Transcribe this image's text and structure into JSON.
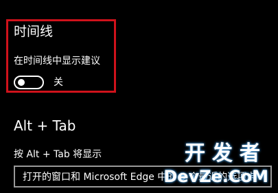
{
  "timeline": {
    "title": "时间线",
    "suggestion_label": "在时间线中显示建议",
    "toggle_state": "关",
    "toggle_on": false
  },
  "alt_tab": {
    "title": "Alt + Tab",
    "label": "按 Alt + Tab 将显示",
    "dropdown_value": "打开的窗口和 Microsoft Edge 中的 5 个最近的选项卡"
  },
  "watermark": {
    "line1": "开发者",
    "line2": "DevZe.CoM"
  },
  "colors": {
    "background": "#000000",
    "text": "#ffffff",
    "highlight_border": "#d0121b",
    "dropdown_border": "#9a9a9a"
  }
}
